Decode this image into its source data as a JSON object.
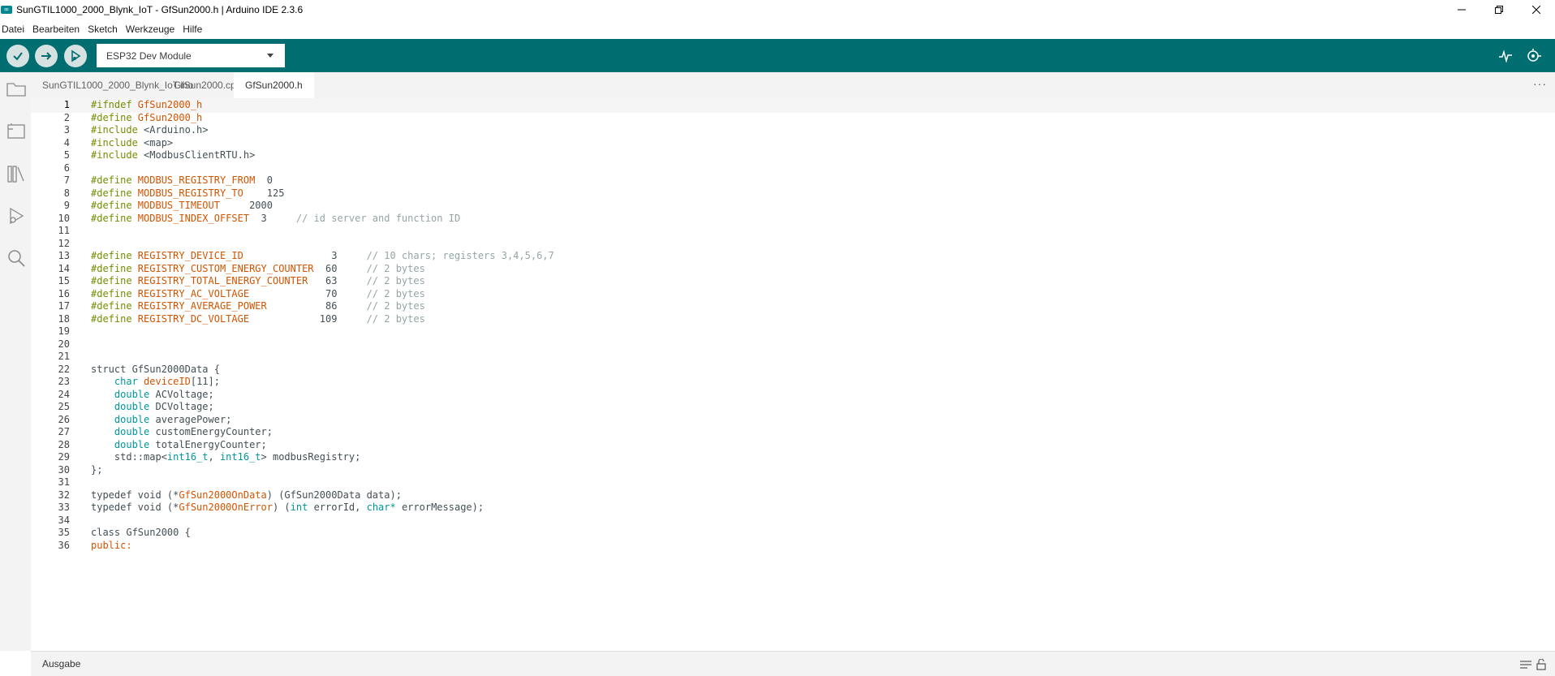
{
  "window": {
    "title": "SunGTIL1000_2000_Blynk_IoT - GfSun2000.h | Arduino IDE 2.3.6",
    "logo_glyph": "∞"
  },
  "menu": [
    "Datei",
    "Bearbeiten",
    "Sketch",
    "Werkzeuge",
    "Hilfe"
  ],
  "toolbar": {
    "board": "ESP32 Dev Module",
    "icons": [
      "verify-icon",
      "upload-icon",
      "debug-icon",
      "serial-plotter-icon",
      "serial-monitor-icon"
    ]
  },
  "tabs": [
    {
      "label": "SunGTIL1000_2000_Blynk_IoT.ino",
      "active": false
    },
    {
      "label": "GfSun2000.cpp",
      "active": false
    },
    {
      "label": "GfSun2000.h",
      "active": true
    }
  ],
  "tabs_more": "···",
  "editor": {
    "current_line": 1,
    "lines": [
      [
        [
          "m",
          "#ifndef "
        ],
        [
          "n",
          "GfSun2000_h"
        ]
      ],
      [
        [
          "m",
          "#define "
        ],
        [
          "n",
          "GfSun2000_h"
        ]
      ],
      [
        [
          "m",
          "#include "
        ],
        [
          "p",
          "<Arduino.h>"
        ]
      ],
      [
        [
          "m",
          "#include "
        ],
        [
          "p",
          "<map>"
        ]
      ],
      [
        [
          "m",
          "#include "
        ],
        [
          "p",
          "<ModbusClientRTU.h>"
        ]
      ],
      [],
      [
        [
          "m",
          "#define "
        ],
        [
          "n",
          "MODBUS_REGISTRY_FROM"
        ],
        [
          "p",
          "  0"
        ]
      ],
      [
        [
          "m",
          "#define "
        ],
        [
          "n",
          "MODBUS_REGISTRY_TO"
        ],
        [
          "p",
          "    125"
        ]
      ],
      [
        [
          "m",
          "#define "
        ],
        [
          "n",
          "MODBUS_TIMEOUT"
        ],
        [
          "p",
          "     2000"
        ]
      ],
      [
        [
          "m",
          "#define "
        ],
        [
          "n",
          "MODBUS_INDEX_OFFSET"
        ],
        [
          "p",
          "  3     "
        ],
        [
          "c",
          "// id server and function ID"
        ]
      ],
      [],
      [],
      [
        [
          "m",
          "#define "
        ],
        [
          "n",
          "REGISTRY_DEVICE_ID"
        ],
        [
          "p",
          "               3     "
        ],
        [
          "c",
          "// 10 chars; registers 3,4,5,6,7"
        ]
      ],
      [
        [
          "m",
          "#define "
        ],
        [
          "n",
          "REGISTRY_CUSTOM_ENERGY_COUNTER"
        ],
        [
          "p",
          "  60     "
        ],
        [
          "c",
          "// 2 bytes"
        ]
      ],
      [
        [
          "m",
          "#define "
        ],
        [
          "n",
          "REGISTRY_TOTAL_ENERGY_COUNTER"
        ],
        [
          "p",
          "   63     "
        ],
        [
          "c",
          "// 2 bytes"
        ]
      ],
      [
        [
          "m",
          "#define "
        ],
        [
          "n",
          "REGISTRY_AC_VOLTAGE"
        ],
        [
          "p",
          "             70     "
        ],
        [
          "c",
          "// 2 bytes"
        ]
      ],
      [
        [
          "m",
          "#define "
        ],
        [
          "n",
          "REGISTRY_AVERAGE_POWER"
        ],
        [
          "p",
          "          86     "
        ],
        [
          "c",
          "// 2 bytes"
        ]
      ],
      [
        [
          "m",
          "#define "
        ],
        [
          "n",
          "REGISTRY_DC_VOLTAGE"
        ],
        [
          "p",
          "            109     "
        ],
        [
          "c",
          "// 2 bytes"
        ]
      ],
      [],
      [],
      [],
      [
        [
          "p",
          "struct GfSun2000Data {"
        ]
      ],
      [
        [
          "p",
          "    "
        ],
        [
          "t",
          "char"
        ],
        [
          "p",
          " "
        ],
        [
          "n",
          "deviceID"
        ],
        [
          "p",
          "[11];"
        ]
      ],
      [
        [
          "p",
          "    "
        ],
        [
          "t",
          "double"
        ],
        [
          "p",
          " ACVoltage;"
        ]
      ],
      [
        [
          "p",
          "    "
        ],
        [
          "t",
          "double"
        ],
        [
          "p",
          " DCVoltage;"
        ]
      ],
      [
        [
          "p",
          "    "
        ],
        [
          "t",
          "double"
        ],
        [
          "p",
          " averagePower;"
        ]
      ],
      [
        [
          "p",
          "    "
        ],
        [
          "t",
          "double"
        ],
        [
          "p",
          " customEnergyCounter;"
        ]
      ],
      [
        [
          "p",
          "    "
        ],
        [
          "t",
          "double"
        ],
        [
          "p",
          " totalEnergyCounter;"
        ]
      ],
      [
        [
          "p",
          "    std::map<"
        ],
        [
          "t",
          "int16_t"
        ],
        [
          "p",
          ", "
        ],
        [
          "t",
          "int16_t"
        ],
        [
          "p",
          "> modbusRegistry;"
        ]
      ],
      [
        [
          "p",
          "};"
        ]
      ],
      [],
      [
        [
          "p",
          "typedef void (*"
        ],
        [
          "n",
          "GfSun2000OnData"
        ],
        [
          "p",
          ") (GfSun2000Data data);"
        ]
      ],
      [
        [
          "p",
          "typedef void (*"
        ],
        [
          "n",
          "GfSun2000OnError"
        ],
        [
          "p",
          ") ("
        ],
        [
          "t",
          "int"
        ],
        [
          "p",
          " errorId, "
        ],
        [
          "t",
          "char*"
        ],
        [
          "p",
          " errorMessage);"
        ]
      ],
      [],
      [
        [
          "p",
          "class GfSun2000 {"
        ]
      ],
      [
        [
          "n",
          "public:"
        ]
      ]
    ]
  },
  "bottom": {
    "output_label": "Ausgabe"
  },
  "colors": {
    "toolbar": "#006d70",
    "macro": "#728e00",
    "identifier": "#d35400",
    "type": "#00979c",
    "comment": "#95a5a6"
  }
}
